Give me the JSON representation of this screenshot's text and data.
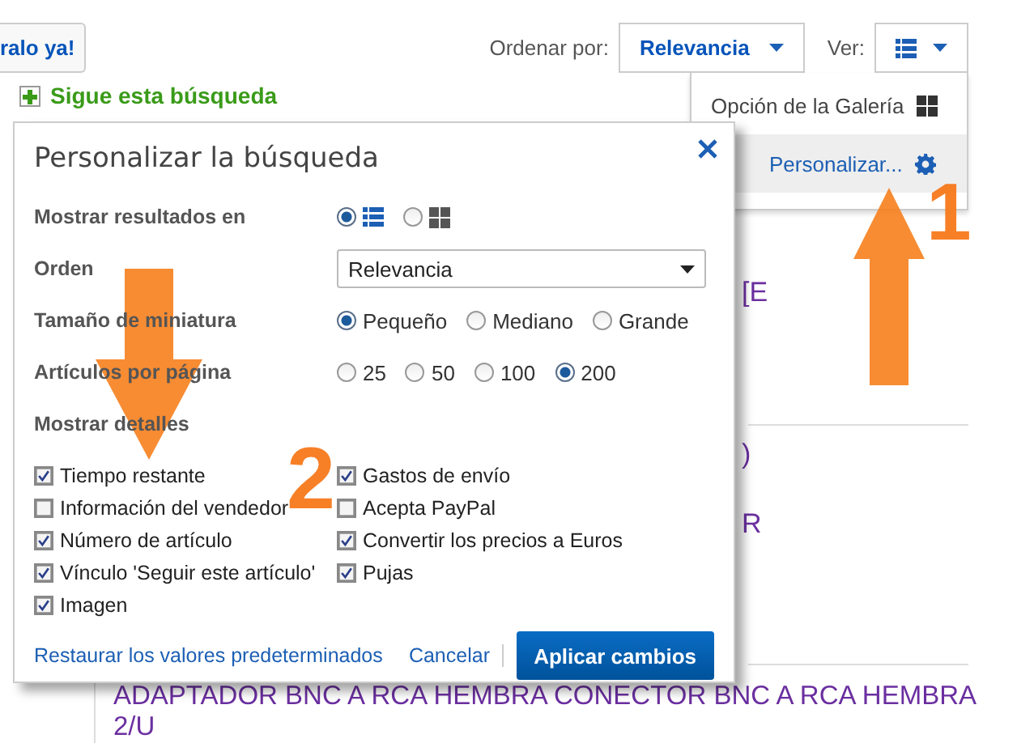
{
  "top_bar": {
    "buy_button": "ralo ya!",
    "sort_label": "Ordenar por:",
    "sort_value": "Relevancia",
    "view_label": "Ver:"
  },
  "follow_search": "Sigue esta búsqueda",
  "view_menu": [
    {
      "label": "Opción de la Galería",
      "kind": "gallery",
      "selected": false
    },
    {
      "label": "Personalizar...",
      "kind": "customize",
      "selected": true
    }
  ],
  "results": [
    {
      "text": "[E",
      "kind": "fragment"
    },
    {
      "text": ")",
      "kind": "fragment"
    },
    {
      "text": "R",
      "kind": "fragment"
    },
    {
      "text": "ADAPTADOR BNC A RCA HEMBRA CONECTOR BNC A RCA HEMBRA 2/U",
      "kind": "title"
    }
  ],
  "dialog": {
    "title": "Personalizar la búsqueda",
    "rows": [
      {
        "kind": "view",
        "label": "Mostrar resultados en",
        "options": [
          {
            "kind": "list",
            "selected": true
          },
          {
            "kind": "grid",
            "selected": false
          }
        ]
      },
      {
        "kind": "select",
        "label": "Orden",
        "value": "Relevancia"
      },
      {
        "kind": "radio",
        "label": "Tamaño de miniatura",
        "options": [
          {
            "label": "Pequeño",
            "selected": true
          },
          {
            "label": "Mediano",
            "selected": false
          },
          {
            "label": "Grande",
            "selected": false
          }
        ]
      },
      {
        "kind": "radio",
        "label": "Artículos por página",
        "options": [
          {
            "label": "25",
            "selected": false
          },
          {
            "label": "50",
            "selected": false
          },
          {
            "label": "100",
            "selected": false
          },
          {
            "label": "200",
            "selected": true
          }
        ]
      },
      {
        "kind": "heading",
        "label": "Mostrar detalles"
      }
    ],
    "details": [
      [
        {
          "label": "Tiempo restante",
          "checked": true
        },
        {
          "label": "Información del vendedor",
          "checked": false
        },
        {
          "label": "Número de artículo",
          "checked": true
        },
        {
          "label": "Vínculo 'Seguir este artículo'",
          "checked": true
        },
        {
          "label": "Imagen",
          "checked": true
        }
      ],
      [
        {
          "label": "Gastos de envío",
          "checked": true
        },
        {
          "label": "Acepta PayPal",
          "checked": false
        },
        {
          "label": "Convertir los precios a Euros",
          "checked": true
        },
        {
          "label": "Pujas",
          "checked": true
        }
      ]
    ],
    "links": [
      "Restaurar los valores predeterminados",
      "Cancelar"
    ],
    "apply": "Aplicar cambios"
  },
  "annotations": [
    {
      "label": "1",
      "kind": "up"
    },
    {
      "label": "2",
      "kind": "down"
    }
  ]
}
